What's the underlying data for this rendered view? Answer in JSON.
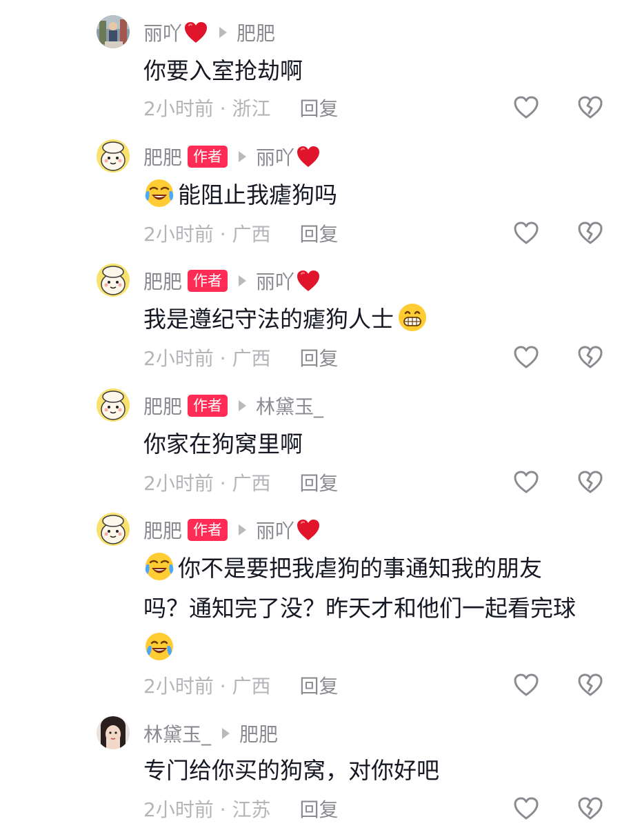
{
  "comments": [
    {
      "author": "丽吖",
      "author_heart": true,
      "badge": "",
      "reply_to": "肥肥",
      "reply_to_heart": false,
      "avatar": "girl-photo",
      "lead_emoji": "",
      "lines": [
        "你要入室抢劫啊"
      ],
      "trail_emoji": "",
      "time_location": "2小时前 · 浙江",
      "reply_label": "回复"
    },
    {
      "author": "肥肥",
      "author_heart": false,
      "badge": "作者",
      "reply_to": "丽吖",
      "reply_to_heart": true,
      "avatar": "cartoon-face",
      "lead_emoji": "crying-laughing",
      "lines": [
        "能阻止我瘧狗吗"
      ],
      "trail_emoji": "",
      "time_location": "2小时前 · 广西",
      "reply_label": "回复"
    },
    {
      "author": "肥肥",
      "author_heart": false,
      "badge": "作者",
      "reply_to": "丽吖",
      "reply_to_heart": true,
      "avatar": "cartoon-face",
      "lead_emoji": "",
      "lines": [
        "我是遵纪守法的瘧狗人士"
      ],
      "trail_emoji": "grinning",
      "time_location": "2小时前 · 广西",
      "reply_label": "回复"
    },
    {
      "author": "肥肥",
      "author_heart": false,
      "badge": "作者",
      "reply_to": "林黛玉_",
      "reply_to_heart": false,
      "avatar": "cartoon-face",
      "lead_emoji": "",
      "lines": [
        "你家在狗窝里啊"
      ],
      "trail_emoji": "",
      "time_location": "2小时前 · 广西",
      "reply_label": "回复"
    },
    {
      "author": "肥肥",
      "author_heart": false,
      "badge": "作者",
      "reply_to": "丽吖",
      "reply_to_heart": true,
      "avatar": "cartoon-face",
      "lead_emoji": "crying-laughing",
      "lines": [
        "你不是要把我虐狗的事通知我的朋友",
        "吗？通知完了没？昨天才和他们一起看完球"
      ],
      "trail_emoji": "",
      "extra_line_emoji": "tears-of-joy",
      "time_location": "2小时前 · 广西",
      "reply_label": "回复"
    },
    {
      "author": "林黛玉_",
      "author_heart": false,
      "badge": "",
      "reply_to": "肥肥",
      "reply_to_heart": false,
      "avatar": "woman-photo",
      "lead_emoji": "",
      "lines": [
        "专门给你买的狗窝，对你好吧"
      ],
      "trail_emoji": "",
      "time_location": "2小时前 · 江苏",
      "reply_label": "回复"
    }
  ],
  "icons": {
    "like": "heart-outline-icon",
    "dislike": "broken-heart-outline-icon",
    "reply_arrow": "play-triangle-icon",
    "red_heart": "red-heart-emoji"
  },
  "colors": {
    "badge": "#fe2c55",
    "name": "#8a8b91",
    "meta": "#b4b5b9",
    "text": "#161823"
  }
}
